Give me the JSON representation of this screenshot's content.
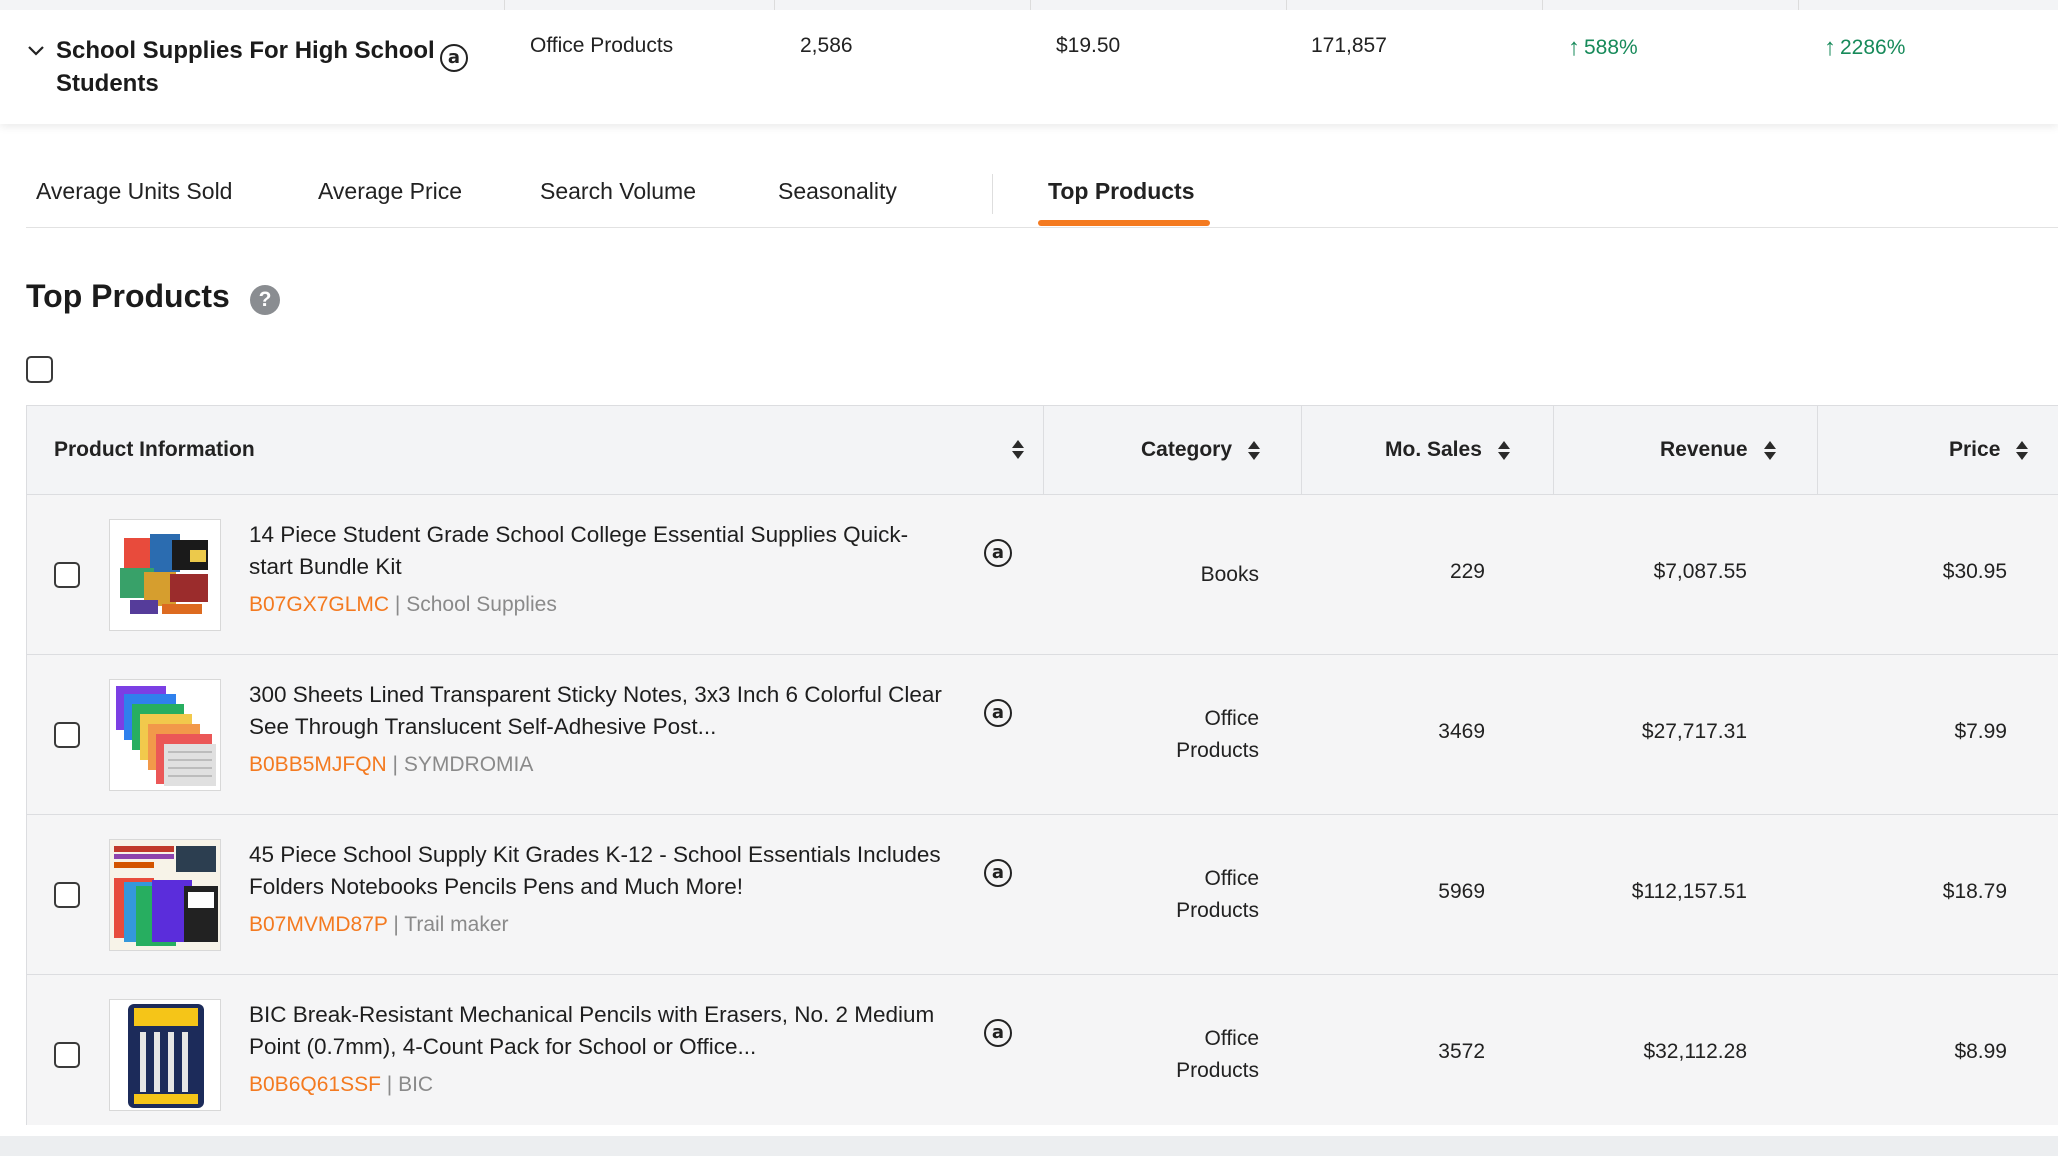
{
  "keyword_row": {
    "name": "School Supplies For High School Students",
    "category": "Office Products",
    "units": "2,586",
    "price": "$19.50",
    "search_volume": "171,857",
    "growth_1": "588%",
    "growth_2": "2286%",
    "amazon_badge": "a"
  },
  "tabs": [
    {
      "label": "Average Units Sold"
    },
    {
      "label": "Average Price"
    },
    {
      "label": "Search Volume"
    },
    {
      "label": "Seasonality"
    },
    {
      "label": "Top Products"
    }
  ],
  "active_tab": "Top Products",
  "section": {
    "title": "Top Products",
    "help": "?"
  },
  "table": {
    "headers": {
      "product_info": "Product Information",
      "category": "Category",
      "mo_sales": "Mo. Sales",
      "revenue": "Revenue",
      "price": "Price"
    },
    "rows": [
      {
        "title": "14 Piece Student Grade School College Essential Supplies Quick-start Bundle Kit",
        "asin": "B07GX7GLMC",
        "brand": "School Supplies",
        "category_line1": "Books",
        "category_line2": "",
        "mo_sales": "229",
        "revenue": "$7,087.55",
        "price": "$30.95"
      },
      {
        "title": "300 Sheets Lined Transparent Sticky Notes, 3x3 Inch 6 Colorful Clear See Through Translucent Self-Adhesive Post...",
        "asin": "B0BB5MJFQN",
        "brand": "SYMDROMIA",
        "category_line1": "Office",
        "category_line2": "Products",
        "mo_sales": "3469",
        "revenue": "$27,717.31",
        "price": "$7.99"
      },
      {
        "title": "45 Piece School Supply Kit Grades K-12 - School Essentials Includes Folders Notebooks Pencils Pens and Much More!",
        "asin": "B07MVMD87P",
        "brand": "Trail maker",
        "category_line1": "Office",
        "category_line2": "Products",
        "mo_sales": "5969",
        "revenue": "$112,157.51",
        "price": "$18.79"
      },
      {
        "title": "BIC Break-Resistant Mechanical Pencils with Erasers, No. 2 Medium Point (0.7mm), 4-Count Pack for School or Office...",
        "asin": "B0B6Q61SSF",
        "brand": "BIC",
        "category_line1": "Office",
        "category_line2": "Products",
        "mo_sales": "3572",
        "revenue": "$32,112.28",
        "price": "$8.99"
      }
    ]
  },
  "separator": "|",
  "icons": {
    "expand": "chevron-down-icon",
    "growth": "arrow-up-icon",
    "sort": "sort-icon",
    "help": "question-icon",
    "amazon": "amazon-icon"
  },
  "colors": {
    "accent": "#f47a20",
    "growth": "#178a5a",
    "header_bg": "#f3f4f6",
    "row_bg": "#f5f5f6"
  }
}
